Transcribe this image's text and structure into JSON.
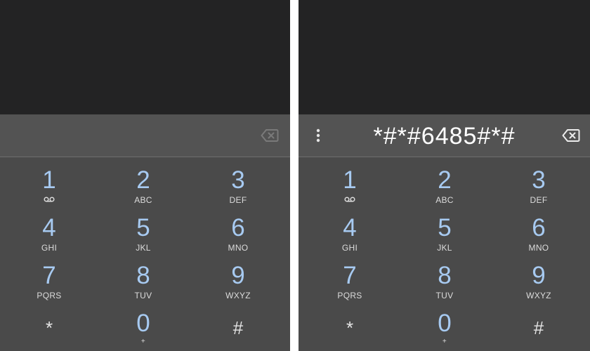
{
  "left_panel": {
    "dialed_number": "",
    "keys": [
      {
        "digit": "1",
        "letters": "",
        "icon": "voicemail-icon"
      },
      {
        "digit": "2",
        "letters": "ABC"
      },
      {
        "digit": "3",
        "letters": "DEF"
      },
      {
        "digit": "4",
        "letters": "GHI"
      },
      {
        "digit": "5",
        "letters": "JKL"
      },
      {
        "digit": "6",
        "letters": "MNO"
      },
      {
        "digit": "7",
        "letters": "PQRS"
      },
      {
        "digit": "8",
        "letters": "TUV"
      },
      {
        "digit": "9",
        "letters": "WXYZ"
      },
      {
        "digit": "*",
        "letters": ""
      },
      {
        "digit": "0",
        "letters": "+"
      },
      {
        "digit": "#",
        "letters": ""
      }
    ]
  },
  "right_panel": {
    "dialed_number": "*#*#6485#*#",
    "keys": [
      {
        "digit": "1",
        "letters": "",
        "icon": "voicemail-icon"
      },
      {
        "digit": "2",
        "letters": "ABC"
      },
      {
        "digit": "3",
        "letters": "DEF"
      },
      {
        "digit": "4",
        "letters": "GHI"
      },
      {
        "digit": "5",
        "letters": "JKL"
      },
      {
        "digit": "6",
        "letters": "MNO"
      },
      {
        "digit": "7",
        "letters": "PQRS"
      },
      {
        "digit": "8",
        "letters": "TUV"
      },
      {
        "digit": "9",
        "letters": "WXYZ"
      },
      {
        "digit": "*",
        "letters": ""
      },
      {
        "digit": "0",
        "letters": "+"
      },
      {
        "digit": "#",
        "letters": ""
      }
    ]
  },
  "colors": {
    "digit": "#a7caf1",
    "background": "#4a4a4a",
    "top_area": "#232324",
    "divider": "#ffffff"
  }
}
